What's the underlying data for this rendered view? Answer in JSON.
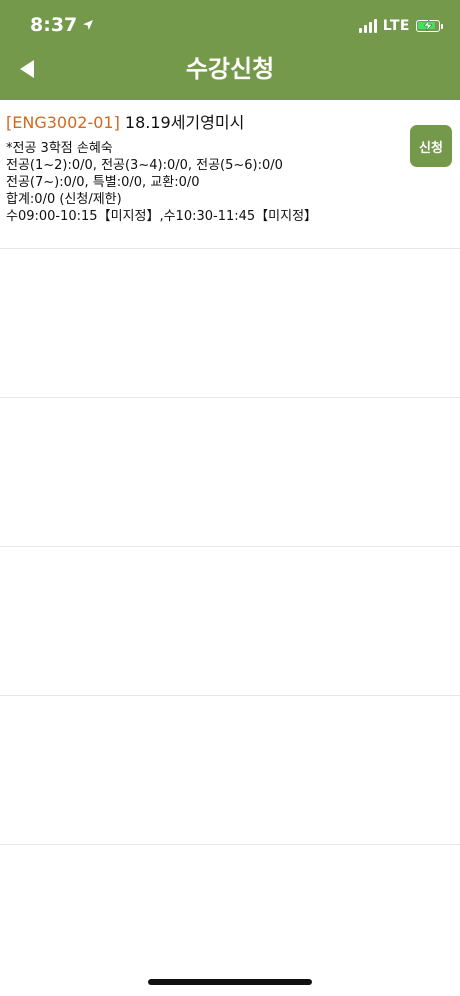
{
  "status_bar": {
    "time": "8:37",
    "network": "LTE",
    "location_icon": "location-arrow-icon",
    "signal_icon": "signal-bars-icon",
    "battery_icon": "battery-charging-icon"
  },
  "header": {
    "title": "수강신청",
    "back_icon": "back-arrow-icon"
  },
  "colors": {
    "header_bg": "#74994b",
    "accent_code": "#d2691e",
    "button_bg": "#74994b"
  },
  "courses": [
    {
      "code": "[ENG3002-01]",
      "name": "18.19세기영미시",
      "details": [
        "*전공 3학점 손혜숙",
        "전공(1~2):0/0, 전공(3~4):0/0, 전공(5~6):0/0",
        "전공(7~):0/0, 특별:0/0, 교환:0/0",
        "합계:0/0 (신청/제한)",
        "수09:00-10:15【미지정】,수10:30-11:45【미지정】"
      ],
      "apply_label": "신청"
    }
  ]
}
